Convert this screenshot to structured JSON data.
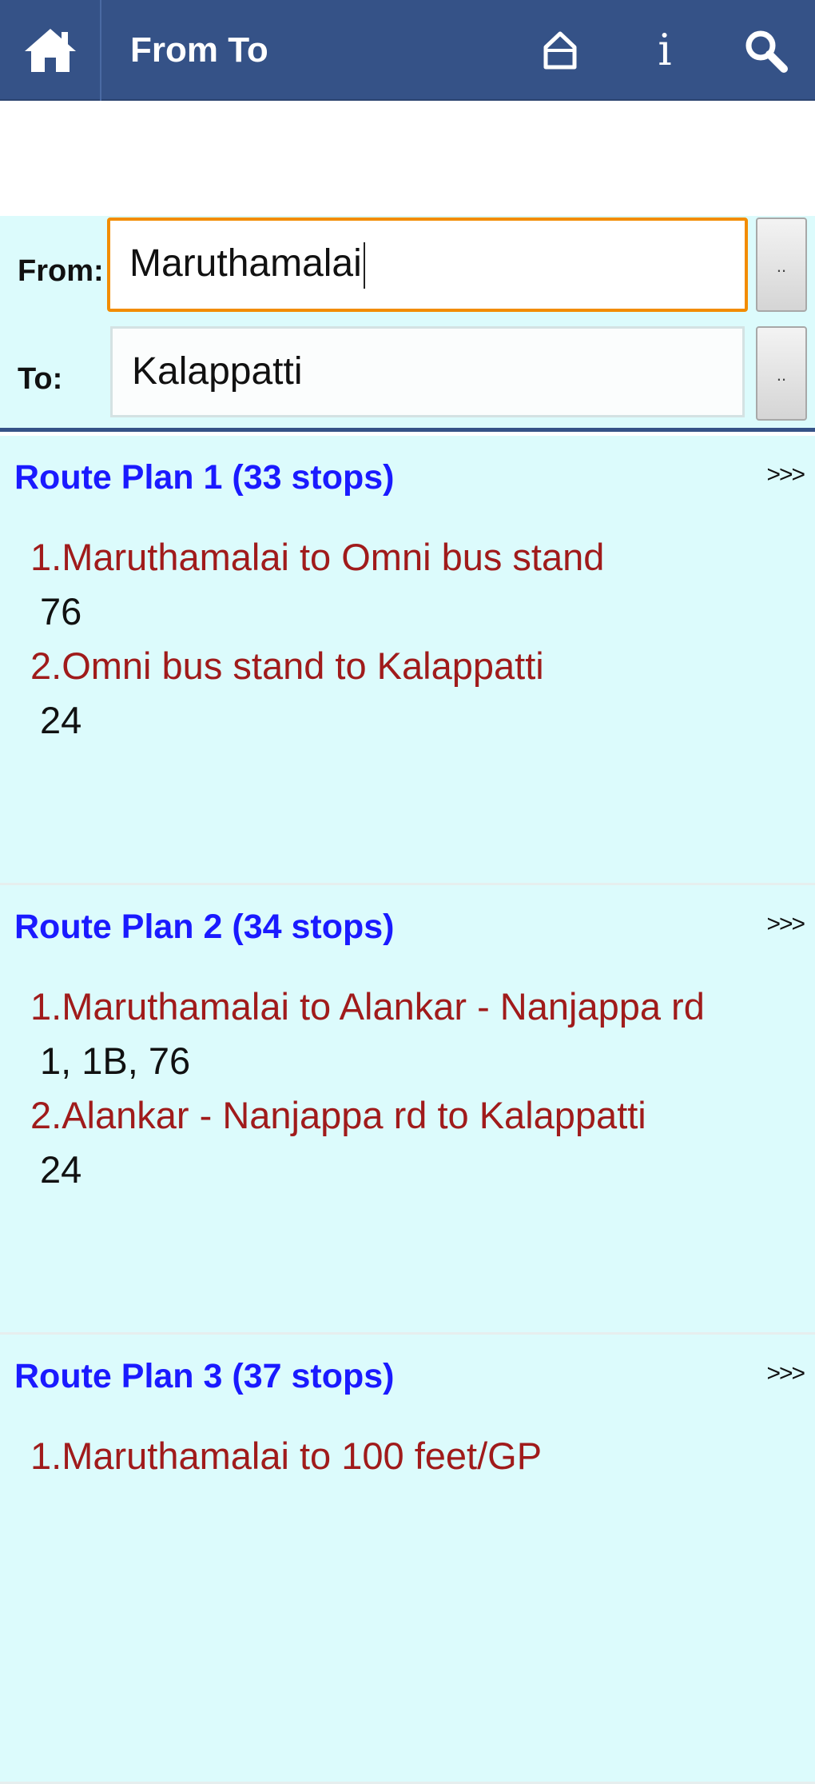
{
  "appbar": {
    "title": "From To",
    "colors": {
      "background": "#355287",
      "title": "#ffffff"
    },
    "icons": [
      "home-icon",
      "outline-home-icon",
      "info-icon",
      "search-icon"
    ]
  },
  "form": {
    "from_label": "From:",
    "from_value": "Maruthamalai",
    "to_label": "To:",
    "to_value": "Kalappatti",
    "picker_label": ".."
  },
  "plans": [
    {
      "title": "Route Plan 1 (33 stops)",
      "more": ">>>",
      "legs": [
        {
          "route": "1.Maruthamalai to Omni bus stand",
          "buses": "76"
        },
        {
          "route": "2.Omni bus stand to Kalappatti",
          "buses": "24"
        }
      ]
    },
    {
      "title": "Route Plan 2 (34 stops)",
      "more": ">>>",
      "legs": [
        {
          "route": "1.Maruthamalai to Alankar - Nanjappa rd",
          "buses": "1, 1B, 76"
        },
        {
          "route": "2.Alankar - Nanjappa rd to Kalappatti",
          "buses": "24"
        }
      ]
    },
    {
      "title": "Route Plan 3 (37 stops)",
      "more": ">>>",
      "legs": [
        {
          "route": "1.Maruthamalai to 100 feet/GP",
          "buses": ""
        }
      ]
    }
  ]
}
